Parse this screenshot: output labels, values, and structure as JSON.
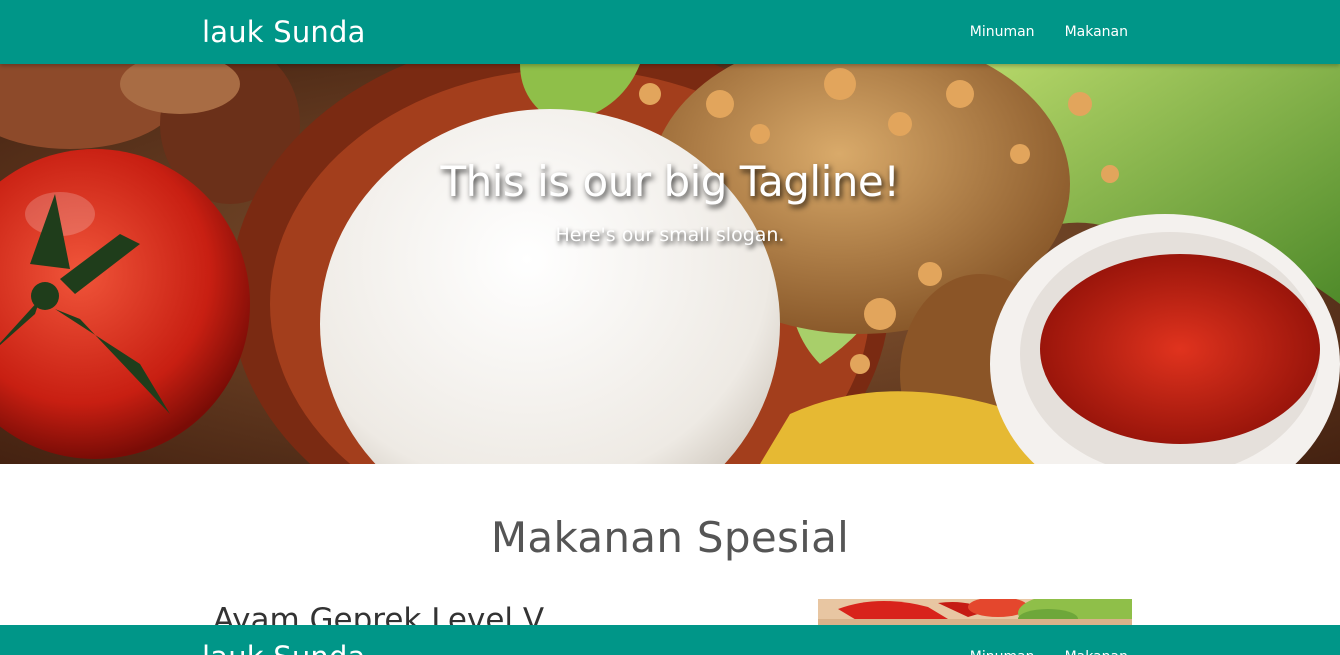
{
  "navbar": {
    "brand": "lauk Sunda",
    "links": [
      "Minuman",
      "Makanan"
    ]
  },
  "hero": {
    "tagline": "This is our big Tagline!",
    "slogan": "Here's our small slogan."
  },
  "section": {
    "title": "Makanan Spesial",
    "items": [
      {
        "name": "Ayam Geprek Level V"
      }
    ]
  },
  "footer": {
    "brand": "lauk Sunda",
    "links": [
      "Minuman",
      "Makanan"
    ]
  },
  "colors": {
    "primary": "#009688",
    "text": "#555555"
  }
}
